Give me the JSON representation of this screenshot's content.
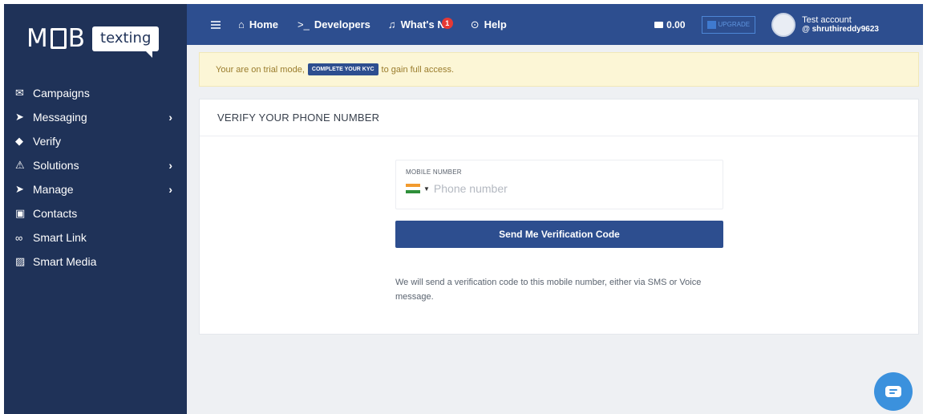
{
  "logo": {
    "part1": "M",
    "part2": "B",
    "part3": "texting"
  },
  "sidebar": {
    "items": [
      {
        "label": "Campaigns",
        "icon": "megaphone-icon",
        "glyph": "✉",
        "chevron": ""
      },
      {
        "label": "Messaging",
        "icon": "send-icon",
        "glyph": "➤",
        "chevron": "›"
      },
      {
        "label": "Verify",
        "icon": "shield-check-icon",
        "glyph": "◆",
        "chevron": ""
      },
      {
        "label": "Solutions",
        "icon": "warning-icon",
        "glyph": "⚠",
        "chevron": "›"
      },
      {
        "label": "Manage",
        "icon": "send-icon",
        "glyph": "➤",
        "chevron": "›"
      },
      {
        "label": "Contacts",
        "icon": "contacts-icon",
        "glyph": "▣",
        "chevron": ""
      },
      {
        "label": "Smart Link",
        "icon": "link-icon",
        "glyph": "∞",
        "chevron": ""
      },
      {
        "label": "Smart Media",
        "icon": "image-icon",
        "glyph": "▨",
        "chevron": ""
      }
    ]
  },
  "topbar": {
    "home": "Home",
    "developers": "Developers",
    "whats_new": "What's N",
    "whats_new_badge": "1",
    "help": "Help",
    "balance": "0.00",
    "upgrade": "UPGRADE",
    "account_name": "Test account",
    "account_user": "@ shruthireddy9623"
  },
  "trial": {
    "prefix": "Your are on trial mode,",
    "kyc_button": "COMPLETE YOUR KYC",
    "suffix": "to gain full access."
  },
  "verify": {
    "title": "VERIFY YOUR PHONE NUMBER",
    "field_label": "MOBILE NUMBER",
    "placeholder": "Phone number",
    "value": "",
    "country": "India",
    "send_button": "Send Me Verification Code",
    "note": "We will send a verification code to this mobile number, either via SMS or Voice message."
  },
  "colors": {
    "sidebar": "#1f3258",
    "topbar": "#2d4e8f",
    "primary_button": "#2d4e8f",
    "trial_bg": "#fcf6d6",
    "chat": "#3b91dd"
  }
}
